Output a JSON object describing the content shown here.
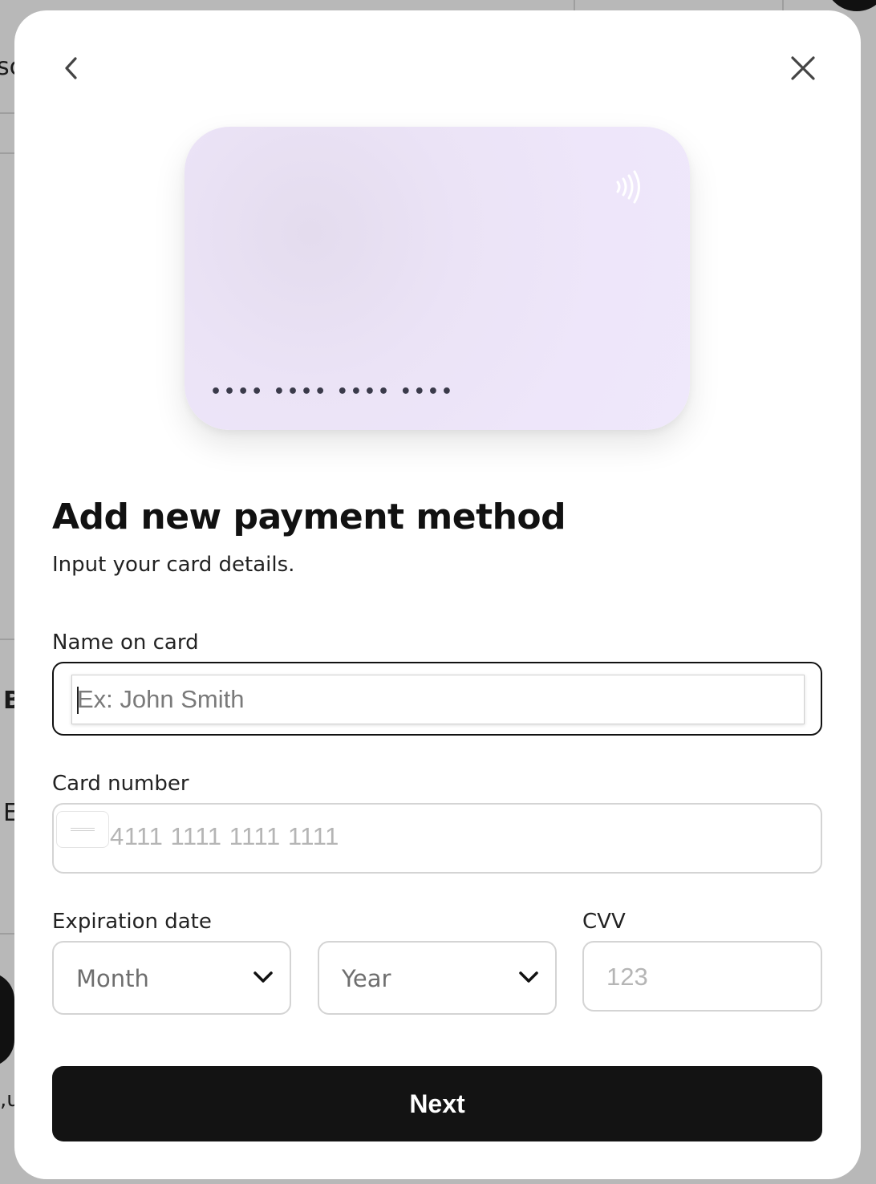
{
  "background": {
    "fragments": [
      "sc",
      "B",
      "E",
      ",u"
    ]
  },
  "modal": {
    "back_icon": "chevron-left-icon",
    "close_icon": "close-icon",
    "card_preview": {
      "contactless_icon": "contactless-icon",
      "number_mask": "•••• •••• •••• ••••",
      "gradient_colors": [
        "#e4dcee",
        "#efe8fb"
      ]
    },
    "title": "Add new payment method",
    "subtitle": "Input your card details.",
    "name_field": {
      "label": "Name on card",
      "placeholder": "Ex: John Smith",
      "value": ""
    },
    "card_number_field": {
      "label": "Card number",
      "placeholder": "4111 1111 1111 1111",
      "brand_icon": "card-brand-icon"
    },
    "expiration": {
      "label": "Expiration date",
      "month_selected": "Month",
      "year_selected": "Year"
    },
    "cvv_field": {
      "label": "CVV",
      "placeholder": "123"
    },
    "next_button": "Next"
  },
  "colors": {
    "overlay": "#b8b8b8",
    "primary_button": "#131313",
    "field_border": "#d4d4d4",
    "focused_border": "#111111",
    "card_preview": "#ece4f8"
  }
}
